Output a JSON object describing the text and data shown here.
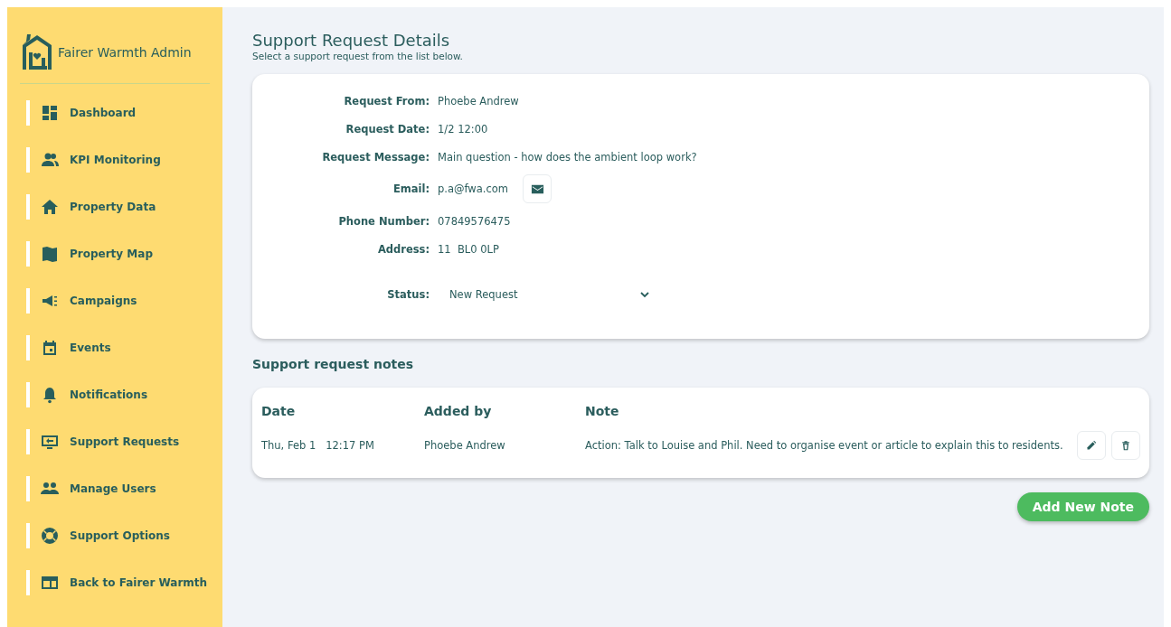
{
  "sidebar": {
    "brand": "Fairer Warmth Admin",
    "items": [
      {
        "label": "Dashboard"
      },
      {
        "label": "KPI Monitoring"
      },
      {
        "label": "Property Data"
      },
      {
        "label": "Property Map"
      },
      {
        "label": "Campaigns"
      },
      {
        "label": "Events"
      },
      {
        "label": "Notifications"
      },
      {
        "label": "Support Requests"
      },
      {
        "label": "Manage Users"
      },
      {
        "label": "Support Options"
      },
      {
        "label": "Back to Fairer Warmth"
      }
    ]
  },
  "page": {
    "title": "Support Request Details",
    "subtitle": "Select a support request from the list below."
  },
  "details": [
    {
      "label": "Request From:",
      "value": "Phoebe Andrew",
      "kind": "text"
    },
    {
      "label": "Request Date:",
      "value": "1/2 12:00",
      "kind": "text"
    },
    {
      "label": "Request Message:",
      "value": "Main question - how does the ambient loop work?",
      "kind": "text"
    },
    {
      "label": "Email:",
      "value": "p.a@fwa.com",
      "kind": "email"
    },
    {
      "label": "Phone Number:",
      "value": "07849576475",
      "kind": "text"
    },
    {
      "label": "Address:",
      "value": "11  BL0 0LP",
      "kind": "text"
    },
    {
      "label": "Status:",
      "value": "New Request",
      "kind": "select"
    }
  ],
  "notes": {
    "heading": "Support request notes",
    "columns": [
      "Date",
      "Added by",
      "Note"
    ],
    "rows": [
      {
        "date": "Thu, Feb 1   12:17 PM",
        "added_by": "Phoebe Andrew",
        "note": "Action: Talk to Louise and Phil. Need to organise event or article to explain this to residents."
      }
    ],
    "add_button": "Add New Note"
  }
}
